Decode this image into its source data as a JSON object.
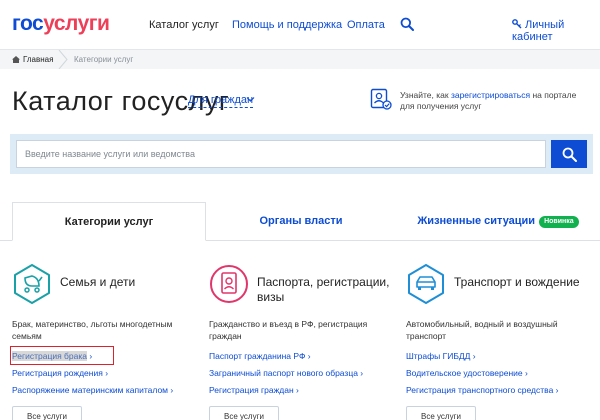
{
  "header": {
    "logo_part1": "гос",
    "logo_part2": "услуги",
    "nav": {
      "catalog": "Каталог услуг",
      "help": "Помощь и поддержка",
      "payment": "Оплата"
    },
    "cabinet": "Личный кабинет"
  },
  "breadcrumb": {
    "home": "Главная",
    "current": "Категории услуг"
  },
  "title": {
    "heading": "Каталог госуслуг",
    "audience": "Для граждан"
  },
  "register": {
    "prefix": "Узнайте, как ",
    "link": "зарегистрироваться",
    "suffix": " на портале для получения услуг"
  },
  "search": {
    "placeholder": "Введите название услуги или ведомства"
  },
  "tabs": {
    "categories": "Категории услуг",
    "authorities": "Органы власти",
    "life": "Жизненные ситуации",
    "badge": "Новинка"
  },
  "categories": [
    {
      "title": "Семья и дети",
      "desc": "Брак, материнство, льготы многодетным семьям",
      "links": [
        "Регистрация брака",
        "Регистрация рождения",
        "Распоряжение материнским капиталом"
      ],
      "all": "Все услуги"
    },
    {
      "title": "Паспорта, регистрации, визы",
      "desc": "Гражданство и въезд в РФ, регистрация граждан",
      "links": [
        "Паспорт гражданина РФ",
        "Заграничный паспорт нового образца",
        "Регистрация граждан"
      ],
      "all": "Все услуги"
    },
    {
      "title": "Транспорт и вождение",
      "desc": "Автомобильный, водный и воздушный транспорт",
      "links": [
        "Штрафы ГИБДД",
        "Водительское удостоверение",
        "Регистрация транспортного средства"
      ],
      "all": "Все услуги"
    }
  ],
  "colors": {
    "brand_blue": "#0d4cd3",
    "brand_red": "#ee3f58",
    "teal": "#1aa1a8",
    "pink": "#e0366b",
    "sky": "#1e8fd6",
    "highlight": "#d9232e"
  }
}
